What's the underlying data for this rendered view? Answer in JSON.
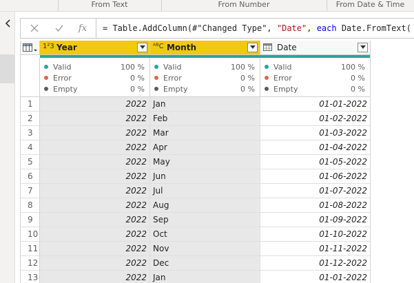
{
  "ribbon": {
    "groups": [
      "From Text",
      "From Number",
      "From Date & Time"
    ]
  },
  "formula_bar": {
    "cancel_icon": "x-icon",
    "commit_icon": "check-icon",
    "fx_label": "fx",
    "formula_prefix": "= Table.AddColumn(#\"Changed Type\", ",
    "formula_string": "\"Date\"",
    "formula_mid": ", ",
    "formula_keyword": "each",
    "formula_suffix": " Date.FromText( Text.C"
  },
  "columns": [
    {
      "type_glyph": "1²3",
      "name": "Year",
      "valid": "100 %",
      "error": "0 %",
      "empty": "0 %"
    },
    {
      "type_glyph": "ᴬᴮC",
      "name": "Month",
      "valid": "100 %",
      "error": "0 %",
      "empty": "0 %"
    },
    {
      "type_glyph": "▦",
      "name": "Date",
      "valid": "100 %",
      "error": "0 %",
      "empty": "0 %"
    }
  ],
  "quality_labels": {
    "valid": "Valid",
    "error": "Error",
    "empty": "Empty"
  },
  "colors": {
    "valid": "#24a89a",
    "error": "#e8624c",
    "empty": "#5c5c5c",
    "header_selected": "#f2c811"
  },
  "rows": [
    {
      "idx": "1",
      "year": "2022",
      "month": "Jan",
      "date": "01-01-2022"
    },
    {
      "idx": "2",
      "year": "2022",
      "month": "Feb",
      "date": "01-02-2022"
    },
    {
      "idx": "3",
      "year": "2022",
      "month": "Mar",
      "date": "01-03-2022"
    },
    {
      "idx": "4",
      "year": "2022",
      "month": "Apr",
      "date": "01-04-2022"
    },
    {
      "idx": "5",
      "year": "2022",
      "month": "May",
      "date": "01-05-2022"
    },
    {
      "idx": "6",
      "year": "2022",
      "month": "Jun",
      "date": "01-06-2022"
    },
    {
      "idx": "7",
      "year": "2022",
      "month": "Jul",
      "date": "01-07-2022"
    },
    {
      "idx": "8",
      "year": "2022",
      "month": "Aug",
      "date": "01-08-2022"
    },
    {
      "idx": "9",
      "year": "2022",
      "month": "Sep",
      "date": "01-09-2022"
    },
    {
      "idx": "10",
      "year": "2022",
      "month": "Oct",
      "date": "01-10-2022"
    },
    {
      "idx": "11",
      "year": "2022",
      "month": "Nov",
      "date": "01-11-2022"
    },
    {
      "idx": "12",
      "year": "2022",
      "month": "Dec",
      "date": "01-12-2022"
    },
    {
      "idx": "13",
      "year": "2022",
      "month": "Jan",
      "date": "01-01-2022"
    }
  ]
}
